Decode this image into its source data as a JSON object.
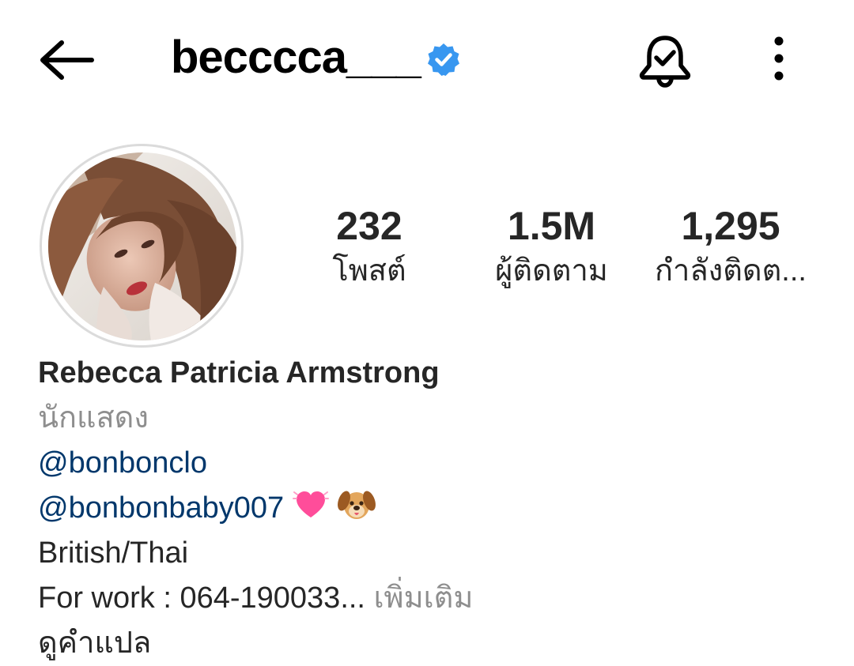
{
  "header": {
    "username": "becccca___",
    "icons": [
      "back-arrow-icon",
      "verified-badge-icon",
      "bell-check-icon",
      "more-vertical-icon"
    ],
    "verified_color": "#3897f0"
  },
  "profile": {
    "stats": [
      {
        "value": "232",
        "label": "โพสต์"
      },
      {
        "value": "1.5M",
        "label": "ผู้ติดตาม"
      },
      {
        "value": "1,295",
        "label": "กำลังติดต..."
      }
    ]
  },
  "bio": {
    "full_name": "Rebecca Patricia Armstrong",
    "category": "นักแสดง",
    "mention_1": "@bonbonclo",
    "mention_2": "@bonbonbaby007",
    "emojis": [
      "heart-icon",
      "dog-face-icon"
    ],
    "line_country": "British/Thai",
    "work_text": "For work : 064-190033...",
    "more_label": "เพิ่มเติม",
    "translate_label": "ดูคำแปล"
  },
  "colors": {
    "link": "#00376b",
    "secondary_text": "#8e8e8e",
    "avatar_ring": "#dbdbdb"
  }
}
